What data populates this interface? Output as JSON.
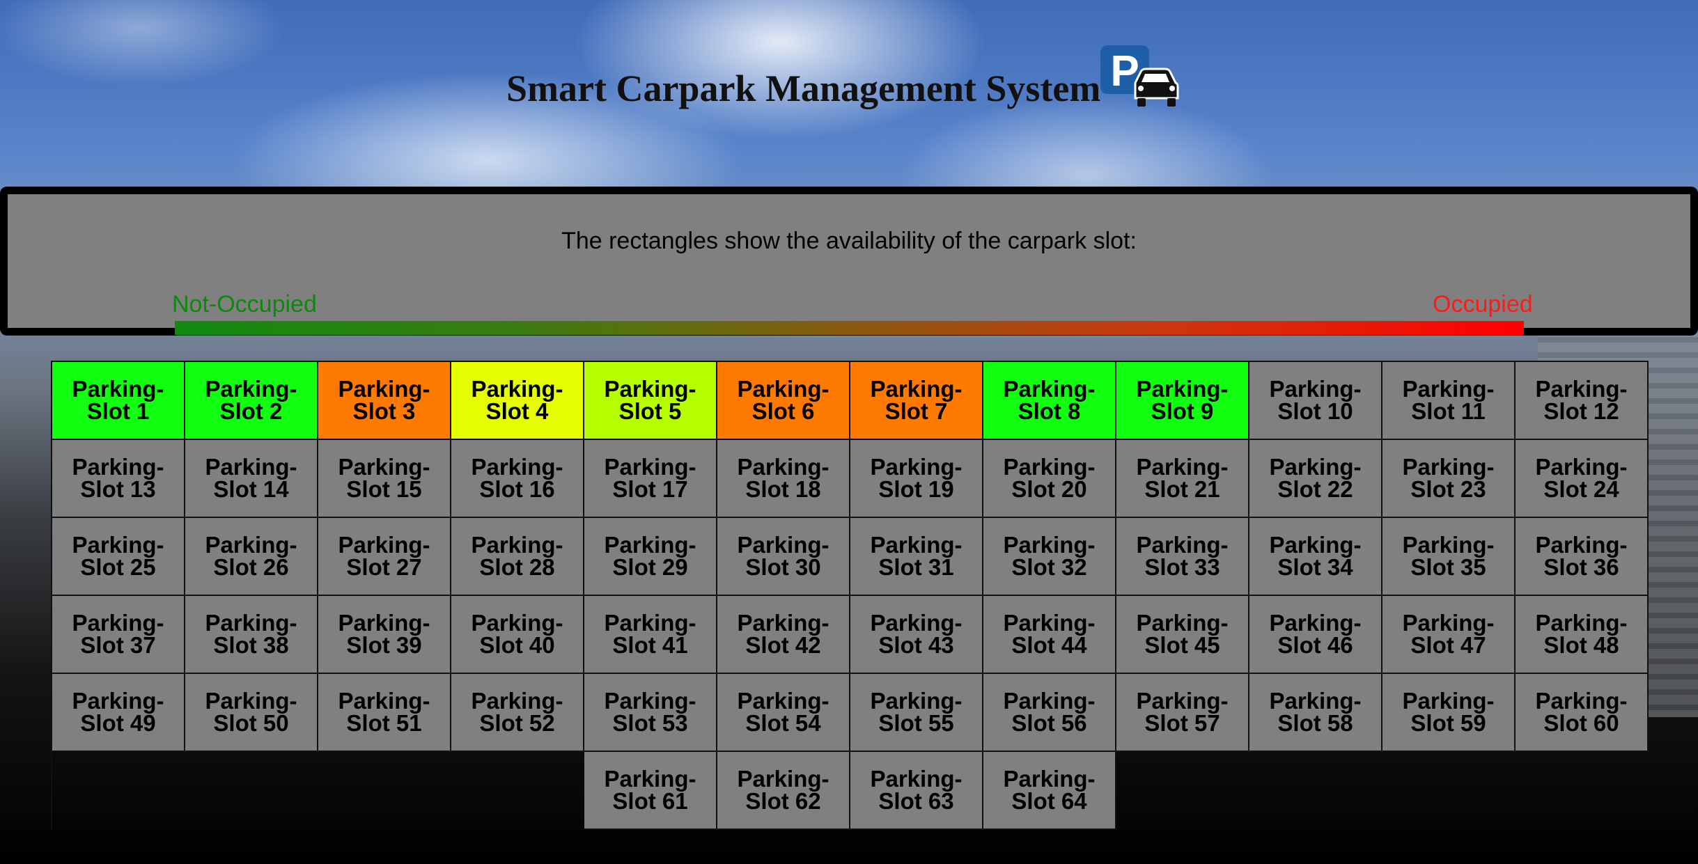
{
  "header": {
    "title": "Smart Carpark Management System",
    "logo_icon": "parking-car-icon",
    "logo_letter": "P"
  },
  "legend": {
    "description": "The rectangles show the availability of the carpark slot:",
    "not_occupied_label": "Not-Occupied",
    "occupied_label": "Occupied",
    "gradient_colors": [
      "#0f8a0f",
      "#ff0000"
    ]
  },
  "colors": {
    "default_slot": "#808080",
    "free": "#12ff12",
    "yellow_green": "#b6ff00",
    "yellow": "#e6ff00",
    "orange": "#ff7a00"
  },
  "slots": [
    {
      "label": "Parking-Slot 1",
      "color": "#12ff12"
    },
    {
      "label": "Parking-Slot 2",
      "color": "#12ff12"
    },
    {
      "label": "Parking-Slot 3",
      "color": "#ff7a00"
    },
    {
      "label": "Parking-Slot 4",
      "color": "#e6ff00"
    },
    {
      "label": "Parking-Slot 5",
      "color": "#b6ff00"
    },
    {
      "label": "Parking-Slot 6",
      "color": "#ff7a00"
    },
    {
      "label": "Parking-Slot 7",
      "color": "#ff7a00"
    },
    {
      "label": "Parking-Slot 8",
      "color": "#12ff12"
    },
    {
      "label": "Parking-Slot 9",
      "color": "#12ff12"
    },
    {
      "label": "Parking-Slot 10"
    },
    {
      "label": "Parking-Slot 11"
    },
    {
      "label": "Parking-Slot 12"
    },
    {
      "label": "Parking-Slot 13"
    },
    {
      "label": "Parking-Slot 14"
    },
    {
      "label": "Parking-Slot 15"
    },
    {
      "label": "Parking-Slot 16"
    },
    {
      "label": "Parking-Slot 17"
    },
    {
      "label": "Parking-Slot 18"
    },
    {
      "label": "Parking-Slot 19"
    },
    {
      "label": "Parking-Slot 20"
    },
    {
      "label": "Parking-Slot 21"
    },
    {
      "label": "Parking-Slot 22"
    },
    {
      "label": "Parking-Slot 23"
    },
    {
      "label": "Parking-Slot 24"
    },
    {
      "label": "Parking-Slot 25"
    },
    {
      "label": "Parking-Slot 26"
    },
    {
      "label": "Parking-Slot 27"
    },
    {
      "label": "Parking-Slot 28"
    },
    {
      "label": "Parking-Slot 29"
    },
    {
      "label": "Parking-Slot 30"
    },
    {
      "label": "Parking-Slot 31"
    },
    {
      "label": "Parking-Slot 32"
    },
    {
      "label": "Parking-Slot 33"
    },
    {
      "label": "Parking-Slot 34"
    },
    {
      "label": "Parking-Slot 35"
    },
    {
      "label": "Parking-Slot 36"
    },
    {
      "label": "Parking-Slot 37"
    },
    {
      "label": "Parking-Slot 38"
    },
    {
      "label": "Parking-Slot 39"
    },
    {
      "label": "Parking-Slot 40"
    },
    {
      "label": "Parking-Slot 41"
    },
    {
      "label": "Parking-Slot 42"
    },
    {
      "label": "Parking-Slot 43"
    },
    {
      "label": "Parking-Slot 44"
    },
    {
      "label": "Parking-Slot 45"
    },
    {
      "label": "Parking-Slot 46"
    },
    {
      "label": "Parking-Slot 47"
    },
    {
      "label": "Parking-Slot 48"
    },
    {
      "label": "Parking-Slot 49"
    },
    {
      "label": "Parking-Slot 50"
    },
    {
      "label": "Parking-Slot 51"
    },
    {
      "label": "Parking-Slot 52"
    },
    {
      "label": "Parking-Slot 53"
    },
    {
      "label": "Parking-Slot 54"
    },
    {
      "label": "Parking-Slot 55"
    },
    {
      "label": "Parking-Slot 56"
    },
    {
      "label": "Parking-Slot 57"
    },
    {
      "label": "Parking-Slot 58"
    },
    {
      "label": "Parking-Slot 59"
    },
    {
      "label": "Parking-Slot 60"
    },
    {
      "label": "Parking-Slot 61"
    },
    {
      "label": "Parking-Slot 62"
    },
    {
      "label": "Parking-Slot 63"
    },
    {
      "label": "Parking-Slot 64"
    }
  ]
}
